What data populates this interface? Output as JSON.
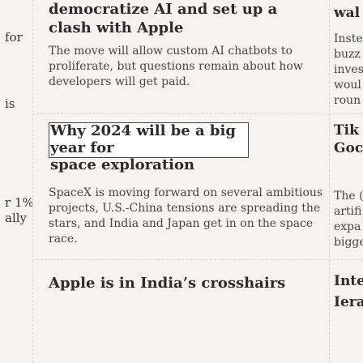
{
  "left_column": {
    "fragments": [
      "for",
      "is",
      "r 1%",
      "ally"
    ]
  },
  "cards": [
    {
      "title": "democratize AI and set up a clash with Apple",
      "summary": "The move will allow custom AI chatbots to proliferate, but questions remain about how developers will get paid."
    },
    {
      "title_line1": "Why 2024 will be a big year for",
      "title_line2": "space exploration",
      "summary": ""
    },
    {
      "title": "",
      "summary": "SpaceX is moving forward on several ambitious projects, U.S.-China tensions are spreading the stars, and India and Japan get in on the space race."
    },
    {
      "title": "Apple is in India’s crosshairs",
      "summary": ""
    }
  ],
  "right_column": {
    "heading_top": "wal",
    "lines_a": [
      "Inste",
      "buzz",
      "inves",
      "woul",
      "roun"
    ],
    "heading_b1": "Tik",
    "heading_b2": "Goc",
    "lines_c": [
      "The (",
      "artifi",
      "expa",
      "bigge"
    ],
    "heading_d1": "Inte",
    "heading_d2": "Iera"
  }
}
